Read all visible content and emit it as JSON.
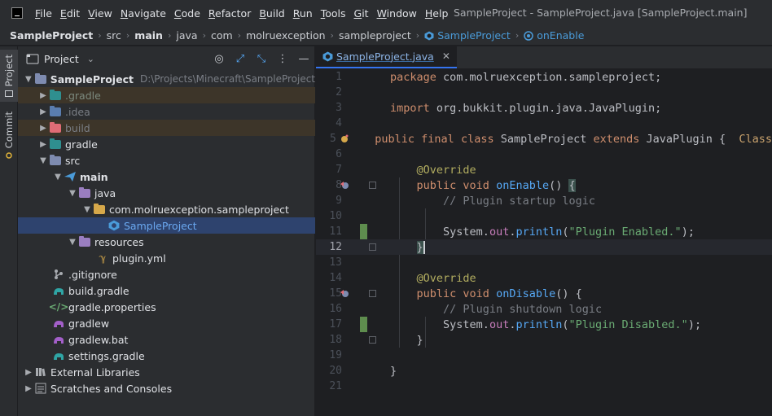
{
  "window": {
    "title": "SampleProject - SampleProject.java [SampleProject.main]"
  },
  "menu": [
    {
      "u": "F",
      "rest": "ile"
    },
    {
      "u": "E",
      "rest": "dit"
    },
    {
      "u": "V",
      "rest": "iew"
    },
    {
      "u": "N",
      "rest": "avigate"
    },
    {
      "u": "C",
      "rest": "ode"
    },
    {
      "u": "R",
      "rest": "efactor"
    },
    {
      "u": "B",
      "rest": "uild"
    },
    {
      "u": "R",
      "rest": "un"
    },
    {
      "u": "T",
      "rest": "ools"
    },
    {
      "u": "G",
      "rest": "it"
    },
    {
      "u": "W",
      "rest": "indow"
    },
    {
      "u": "H",
      "rest": "elp"
    }
  ],
  "breadcrumb": {
    "project": "SampleProject",
    "src": "src",
    "main": "main",
    "java": "java",
    "com": "com",
    "pkg1": "molruexception",
    "pkg2": "sampleproject",
    "class": "SampleProject",
    "method": "onEnable"
  },
  "toolstrip": {
    "project_tab": "Project",
    "commit_tab": "Commit"
  },
  "project_panel": {
    "title": "Project",
    "tree": [
      {
        "label": "SampleProject",
        "path": "D:\\Projects\\Minecraft\\SampleProject"
      },
      {
        "label": ".gradle"
      },
      {
        "label": ".idea"
      },
      {
        "label": "build"
      },
      {
        "label": "gradle"
      },
      {
        "label": "src"
      },
      {
        "label": "main"
      },
      {
        "label": "java"
      },
      {
        "label": "com.molruexception.sampleproject"
      },
      {
        "label": "SampleProject"
      },
      {
        "label": "resources"
      },
      {
        "label": "plugin.yml"
      },
      {
        "label": ".gitignore"
      },
      {
        "label": "build.gradle"
      },
      {
        "label": "gradle.properties"
      },
      {
        "label": "gradlew"
      },
      {
        "label": "gradlew.bat"
      },
      {
        "label": "settings.gradle"
      },
      {
        "label": "External Libraries"
      },
      {
        "label": "Scratches and Consoles"
      }
    ]
  },
  "editor": {
    "tab_label": "SampleProject.java",
    "line_numbers": [
      "1",
      "2",
      "3",
      "4",
      "5",
      "6",
      "7",
      "8",
      "9",
      "10",
      "11",
      "12",
      "13",
      "14",
      "15",
      "16",
      "17",
      "18",
      "19",
      "20",
      "21"
    ],
    "code": {
      "l1_kw": "package",
      "l1_rest": " com.molruexception.sampleproject;",
      "l3_kw": "import",
      "l3_rest": " org.bukkit.plugin.java.JavaPlugin;",
      "l5_kw1": "public final class",
      "l5_name": " SampleProject ",
      "l5_kw2": "extends",
      "l5_rest": " JavaPlugin {",
      "l5_hint": "Class",
      "l7_ann": "@Override",
      "l8_kw": "public void",
      "l8_fn": "onEnable",
      "l8_rest": "() ",
      "l8_brace": "{",
      "l9_cmt": "// Plugin startup logic",
      "l11_obj": "System.",
      "l11_field": "out",
      "l11_dot": ".",
      "l11_fn": "println",
      "l11_open": "(",
      "l11_str": "\"Plugin Enabled.\"",
      "l11_close": ");",
      "l12_brace": "}",
      "l14_ann": "@Override",
      "l15_kw": "public void",
      "l15_fn": "onDisable",
      "l15_rest": "() {",
      "l16_cmt": "// Plugin shutdown logic",
      "l17_obj": "System.",
      "l17_field": "out",
      "l17_dot": ".",
      "l17_fn": "println",
      "l17_open": "(",
      "l17_str": "\"Plugin Disabled.\"",
      "l17_close": ");",
      "l18_brace": "}",
      "l20_brace": "}"
    }
  },
  "colors": {
    "background": "#1e1f22",
    "panel": "#2b2d30",
    "accent": "#3574f0",
    "keyword": "#cf8e6d",
    "function": "#56a8f5",
    "string": "#6aab73",
    "annotation": "#b3ae60",
    "comment": "#7a7e85",
    "changed_line": "#5e8d4e"
  }
}
